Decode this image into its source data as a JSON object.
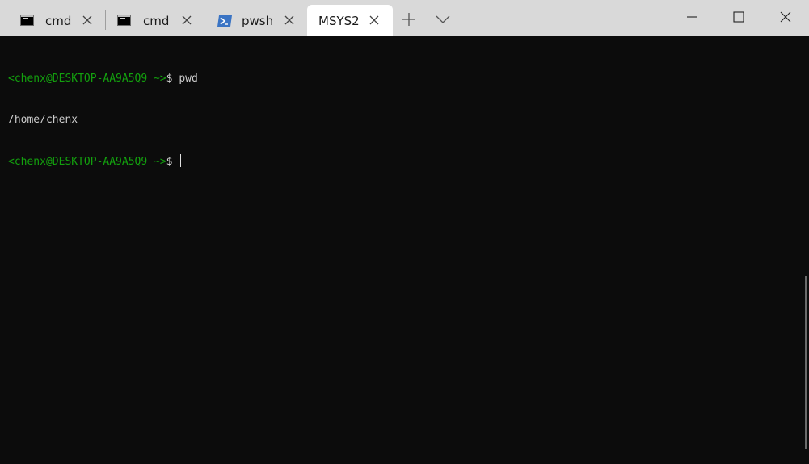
{
  "tabs": [
    {
      "label": "cmd",
      "icon": "cmd-icon",
      "active": false
    },
    {
      "label": "cmd",
      "icon": "cmd-icon",
      "active": false
    },
    {
      "label": "pwsh",
      "icon": "powershell-icon",
      "active": false
    },
    {
      "label": "MSYS2",
      "icon": "",
      "active": true
    }
  ],
  "tabbar": {
    "new_tab_icon": "plus-icon",
    "dropdown_icon": "chevron-down-icon"
  },
  "window_controls": [
    "minimize-icon",
    "maximize-icon",
    "close-icon"
  ],
  "terminal": {
    "lines": [
      {
        "prompt": "<chenx@DESKTOP-AA9A5Q9 ~>",
        "symbol": "$",
        "command": " pwd"
      },
      {
        "output": "/home/chenx"
      },
      {
        "prompt": "<chenx@DESKTOP-AA9A5Q9 ~>",
        "symbol": "$",
        "command": " "
      }
    ]
  },
  "colors": {
    "tabbar_bg": "#d9d9d9",
    "active_tab_bg": "#ffffff",
    "terminal_bg": "#0c0c0c",
    "prompt": "#13a10e",
    "text": "#cccccc",
    "pwsh_icon": "#3a74c4"
  }
}
